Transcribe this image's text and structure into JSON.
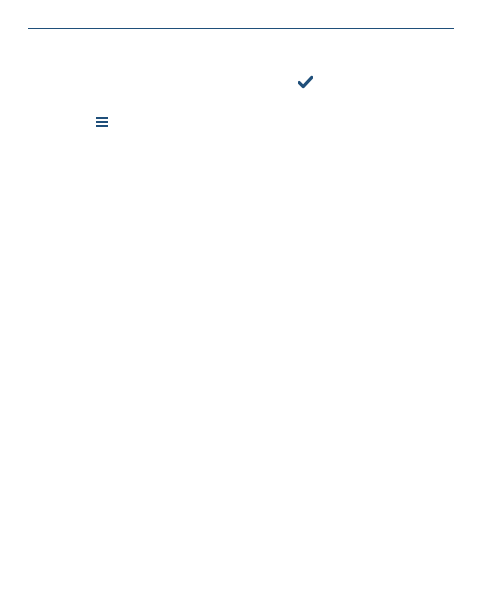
{
  "header": {
    "accent_color": "#1f4f7a"
  },
  "actions": {
    "confirm_icon": "check-icon",
    "menu_icon": "hamburger-menu-icon"
  }
}
